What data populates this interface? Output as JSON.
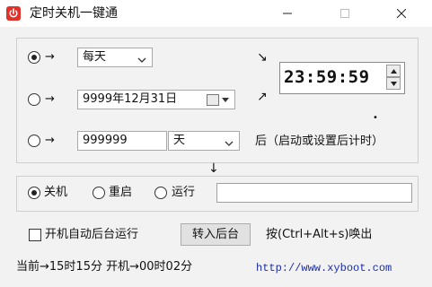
{
  "window": {
    "title": "定时关机一键通"
  },
  "mode_rows": [
    {
      "arrow": "→",
      "combo_value": "每天",
      "checked": true
    },
    {
      "arrow": "→",
      "combo_value": "9999年12月31日",
      "checked": false
    },
    {
      "arrow": "→",
      "num_value": "999999",
      "unit_value": "天",
      "checked": false
    }
  ],
  "diag_arrows": {
    "down_right": "↘",
    "up_right": "↗",
    "down": "↓",
    "dot": "•"
  },
  "time_value": "23:59:59",
  "after_text": "后（启动或设置后计时）",
  "actions": [
    {
      "label": "关机",
      "checked": true
    },
    {
      "label": "重启",
      "checked": false
    },
    {
      "label": "运行",
      "checked": false
    }
  ],
  "autostart_label": "开机自动后台运行",
  "background_button": "转入后台",
  "hotkey_text": "按(Ctrl+Alt+s)唤出",
  "status_text": "当前→15时15分 开机→00时02分",
  "url": "http://www.xyboot.com"
}
